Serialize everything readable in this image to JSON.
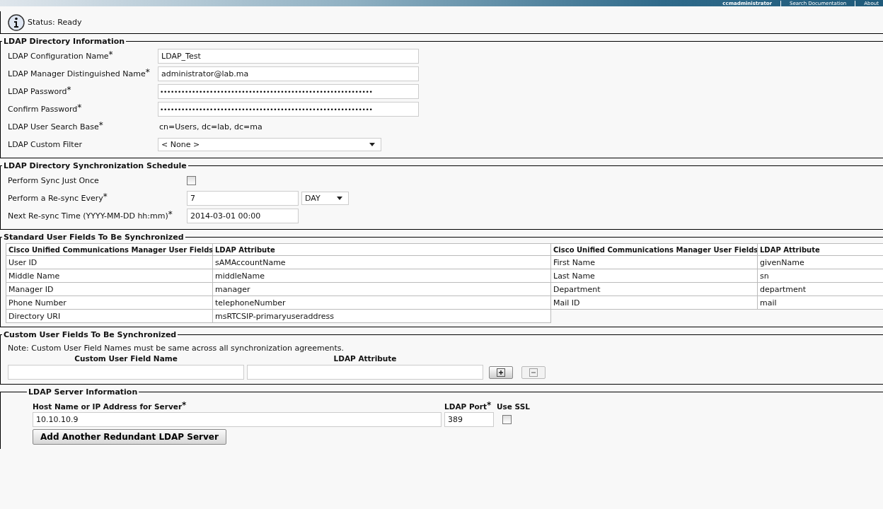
{
  "banner": {
    "user": "ccmadministrator",
    "links": [
      "Search Documentation",
      "About"
    ]
  },
  "status": {
    "text": "Status: Ready"
  },
  "directory_info": {
    "title": "LDAP Directory Information",
    "fields": [
      {
        "kind": "input",
        "label": "LDAP Configuration Name",
        "mark": "*",
        "value": "LDAP_Test"
      },
      {
        "kind": "input",
        "label": "LDAP Manager Distinguished Name",
        "mark": "*",
        "value": "administrator@lab.ma"
      },
      {
        "kind": "password",
        "label": "LDAP Password",
        "mark": "*",
        "value": "••••••••••••••••••••••••••••••••••••••••••••••••••••••••••••"
      },
      {
        "kind": "password",
        "label": "Confirm Password",
        "mark": "*",
        "value": "••••••••••••••••••••••••••••••••••••••••••••••••••••••••••••"
      },
      {
        "kind": "text",
        "label": "LDAP User Search Base",
        "mark": "*",
        "value": "cn=Users, dc=lab, dc=ma"
      },
      {
        "kind": "select",
        "label": "LDAP Custom Filter",
        "value": "< None >"
      }
    ]
  },
  "sync_schedule": {
    "title": "LDAP Directory Synchronization Schedule",
    "sync_once": {
      "label": "Perform Sync Just Once",
      "checked": false
    },
    "resync_every": {
      "label": "Perform a Re-sync Every",
      "mark": "*",
      "value": "7",
      "unit": "DAY"
    },
    "next_resync": {
      "label": "Next Re-sync Time (YYYY-MM-DD hh:mm)",
      "mark": "*",
      "value": "2014-03-01 00:00"
    }
  },
  "standard_fields": {
    "title": "Standard User Fields To Be Synchronized",
    "columns": [
      "Cisco Unified Communications Manager User Fields",
      "LDAP Attribute",
      "Cisco Unified Communications Manager User Fields",
      "LDAP Attribute"
    ],
    "rows": [
      [
        "User ID",
        "sAMAccountName",
        "First Name",
        "givenName"
      ],
      [
        "Middle Name",
        "middleName",
        "Last Name",
        "sn"
      ],
      [
        "Manager ID",
        "manager",
        "Department",
        "department"
      ],
      [
        "Phone Number",
        "telephoneNumber",
        "Mail ID",
        "mail"
      ],
      [
        "Directory URI",
        "msRTCSIP-primaryuseraddress"
      ]
    ]
  },
  "custom_fields": {
    "title": "Custom User Fields To Be Synchronized",
    "note": "Note: Custom User Field Names must be same across all synchronization agreements.",
    "columns": [
      "Custom User Field Name",
      "LDAP Attribute"
    ],
    "buttons": [
      {
        "kind": "add",
        "disabled": false
      },
      {
        "kind": "remove",
        "disabled": true
      }
    ]
  },
  "server_info": {
    "title": "LDAP Server Information",
    "host_label": "Host Name or IP Address for Server",
    "host_mark": "*",
    "port_label": "LDAP Port",
    "port_mark": "*",
    "ssl_label": "Use SSL",
    "host": "10.10.10.9",
    "port": "389",
    "use_ssl": false,
    "add_button": "Add Another Redundant LDAP Server"
  }
}
